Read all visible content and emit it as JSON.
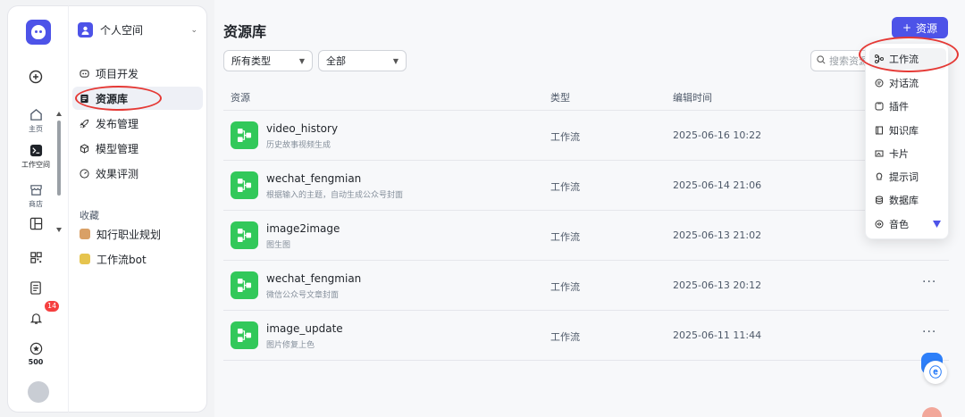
{
  "rail": {
    "items": [
      {
        "label": "主页",
        "icon": "home-icon"
      },
      {
        "label": "工作空间",
        "icon": "terminal-icon"
      },
      {
        "label": "商店",
        "icon": "store-icon"
      }
    ],
    "notification_count": "14",
    "points": "500"
  },
  "space": {
    "name": "个人空间"
  },
  "nav": {
    "items": [
      "项目开发",
      "资源库",
      "发布管理",
      "模型管理",
      "效果评测"
    ],
    "favorites_title": "收藏",
    "favorites": [
      "知行职业规划",
      "工作流bot"
    ]
  },
  "main": {
    "title": "资源库",
    "add_button": "资源",
    "filter_type": "所有类型",
    "filter_scope": "全部",
    "search_placeholder": "搜索资源",
    "columns": [
      "资源",
      "类型",
      "编辑时间"
    ],
    "rows": [
      {
        "name": "video_history",
        "desc": "历史故事视频生成",
        "type": "工作流",
        "time": "2025-06-16 10:22"
      },
      {
        "name": "wechat_fengmian",
        "desc": "根据输入的主题，自动生成公众号封面",
        "type": "工作流",
        "time": "2025-06-14 21:06"
      },
      {
        "name": "image2image",
        "desc": "图生图",
        "type": "工作流",
        "time": "2025-06-13 21:02"
      },
      {
        "name": "wechat_fengmian",
        "desc": "微信公众号文章封面",
        "type": "工作流",
        "time": "2025-06-13 20:12"
      },
      {
        "name": "image_update",
        "desc": "图片修复上色",
        "type": "工作流",
        "time": "2025-06-11 11:44"
      }
    ]
  },
  "dropdown": {
    "items": [
      "工作流",
      "对话流",
      "插件",
      "知识库",
      "卡片",
      "提示词",
      "数据库",
      "音色"
    ]
  },
  "colors": {
    "accent": "#4d53e8",
    "workflow_green": "#32c85a",
    "annotation_red": "#e53935"
  }
}
